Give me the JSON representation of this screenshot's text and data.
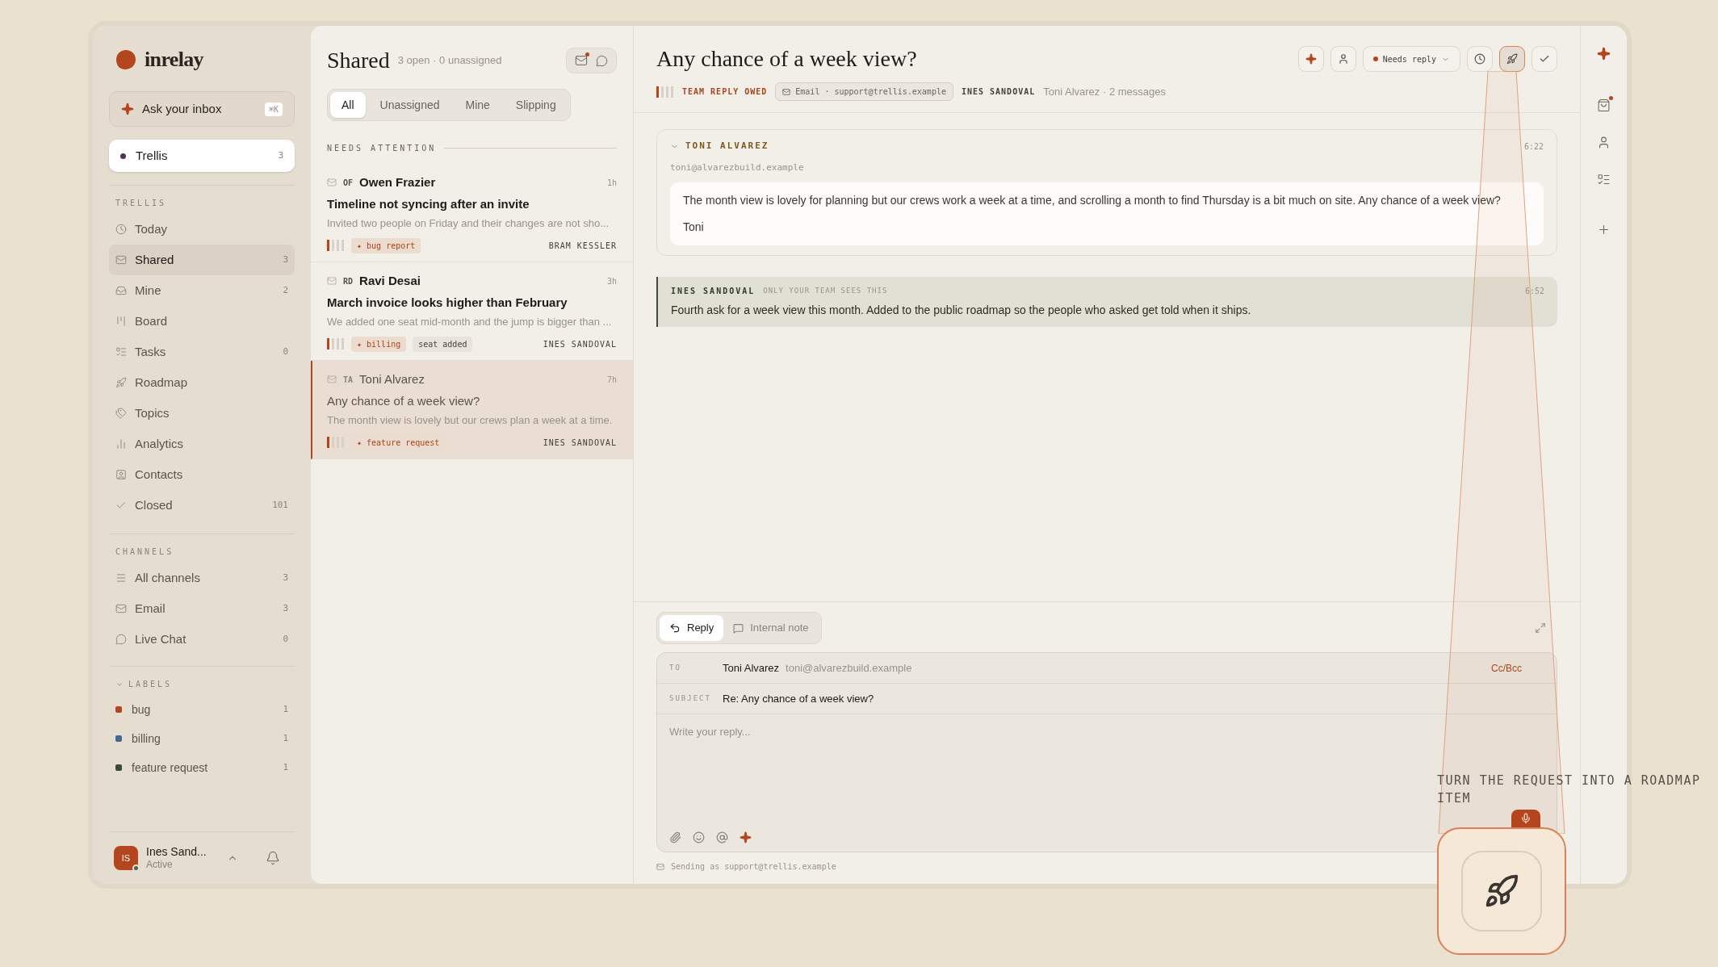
{
  "brand": {
    "name": "inrelay"
  },
  "ask": {
    "label": "Ask your inbox",
    "shortcut": "⌘K"
  },
  "workspace": {
    "name": "Trellis",
    "count": "3"
  },
  "sections": [
    {
      "title": "TRELLIS",
      "items": [
        {
          "label": "Today",
          "selected": false
        },
        {
          "label": "Shared",
          "count": "3",
          "selected": true
        },
        {
          "label": "Mine",
          "count": "2",
          "selected": false
        },
        {
          "label": "Board",
          "selected": false
        },
        {
          "label": "Tasks",
          "count": "0",
          "selected": false
        },
        {
          "label": "Roadmap",
          "selected": false
        },
        {
          "label": "Topics",
          "selected": false
        },
        {
          "label": "Analytics",
          "selected": false
        },
        {
          "label": "Contacts",
          "selected": false
        },
        {
          "label": "Closed",
          "count": "101",
          "selected": false
        }
      ]
    },
    {
      "title": "CHANNELS",
      "items": [
        {
          "label": "All channels",
          "count": "3",
          "selected": false
        },
        {
          "label": "Email",
          "count": "3",
          "selected": false
        },
        {
          "label": "Live Chat",
          "count": "0",
          "selected": false
        }
      ]
    }
  ],
  "labels": {
    "title": "LABELS",
    "expanded": true,
    "items": [
      {
        "label": "bug",
        "count": "1",
        "color": "#b4461f"
      },
      {
        "label": "billing",
        "count": "1",
        "color": "#3d6a8e"
      },
      {
        "label": "feature request",
        "count": "1",
        "color": "#3a4a3a"
      }
    ]
  },
  "user": {
    "initials": "IS",
    "name": "Ines Sand...",
    "status": "Active",
    "online": true
  },
  "list": {
    "title": "Shared",
    "summary": "3 open · 0 unassigned",
    "actions": [
      {
        "kind": "mail",
        "badge": true
      },
      {
        "kind": "chat",
        "badge": false
      }
    ],
    "filters": [
      {
        "label": "All",
        "selected": true
      },
      {
        "label": "Unassigned",
        "selected": false
      },
      {
        "label": "Mine",
        "selected": false
      },
      {
        "label": "Slipping",
        "selected": false
      }
    ],
    "section": "NEEDS ATTENTION",
    "items": [
      {
        "initials": "OF",
        "name": "Owen Frazier",
        "time": "1h",
        "subject": "Timeline not syncing after an invite",
        "preview": "Invited two people on Friday and their changes are not sho...",
        "unread": true,
        "selected": false,
        "tags": [
          {
            "kind": "label",
            "marker": "✦",
            "label": "bug report"
          }
        ],
        "assignee": "BRAM KESSLER"
      },
      {
        "initials": "RD",
        "name": "Ravi Desai",
        "time": "3h",
        "subject": "March invoice looks higher than February",
        "preview": "We added one seat mid-month and the jump is bigger than ...",
        "unread": true,
        "selected": false,
        "tags": [
          {
            "kind": "label",
            "marker": "✦",
            "label": "billing"
          },
          {
            "kind": "plain",
            "label": "seat added"
          }
        ],
        "assignee": "INES SANDOVAL"
      },
      {
        "initials": "TA",
        "name": "Toni Alvarez",
        "time": "7h",
        "subject": "Any chance of a week view?",
        "preview": "The month view is lovely but our crews plan a week at a time.",
        "unread": false,
        "selected": true,
        "tags": [
          {
            "kind": "label",
            "marker": "✦",
            "label": "feature request"
          }
        ],
        "assignee": "INES SANDOVAL"
      }
    ]
  },
  "conversation": {
    "title": "Any chance of a week view?",
    "status_label": "TEAM REPLY OWED",
    "channel": "Email · support@trellis.example",
    "assignee": "INES SANDOVAL",
    "meta": "Toni Alvarez · 2 messages",
    "toolbar": [
      {
        "kind": "sparkle",
        "highlighted": false
      },
      {
        "kind": "person",
        "highlighted": false
      },
      {
        "kind": "status",
        "label": "Needs reply",
        "highlighted": false
      },
      {
        "kind": "snooze",
        "highlighted": false
      },
      {
        "kind": "rocket",
        "highlighted": true
      },
      {
        "kind": "check",
        "highlighted": false
      }
    ],
    "messages": [
      {
        "kind": "email",
        "sender": "TONI ALVAREZ",
        "time": "6:22",
        "email": "toni@alvarezbuild.example",
        "expanded": true,
        "paragraphs": [
          "The month view is lovely for planning but our crews work a week at a time, and scrolling a month to find Thursday is a bit much on site. Any chance of a week view?",
          "Toni"
        ]
      },
      {
        "kind": "note",
        "sender": "INES SANDOVAL",
        "visibility": "ONLY YOUR TEAM SEES THIS",
        "time": "6:52",
        "body": "Fourth ask for a week view this month. Added to the public roadmap so the people who asked get told when it ships."
      }
    ]
  },
  "composer": {
    "modes": [
      {
        "kind": "reply",
        "label": "Reply",
        "selected": true
      },
      {
        "kind": "note",
        "label": "Internal note",
        "selected": false
      }
    ],
    "to_label": "TO",
    "to_name": "Toni Alvarez",
    "to_email": "toni@alvarezbuild.example",
    "cc": "Cc/Bcc",
    "subject_label": "SUBJECT",
    "subject": "Re: Any chance of a week view?",
    "placeholder": "Write your reply...",
    "sending": "Sending as support@trellis.example"
  },
  "rail": [
    {
      "kind": "sparkle",
      "badge": false
    },
    {
      "kind": "bag",
      "badge": true
    },
    {
      "kind": "person",
      "badge": false
    },
    {
      "kind": "tasks",
      "badge": false
    },
    {
      "kind": "plus",
      "badge": false
    }
  ],
  "callout": {
    "caption": "TURN THE REQUEST INTO A ROADMAP ITEM"
  }
}
